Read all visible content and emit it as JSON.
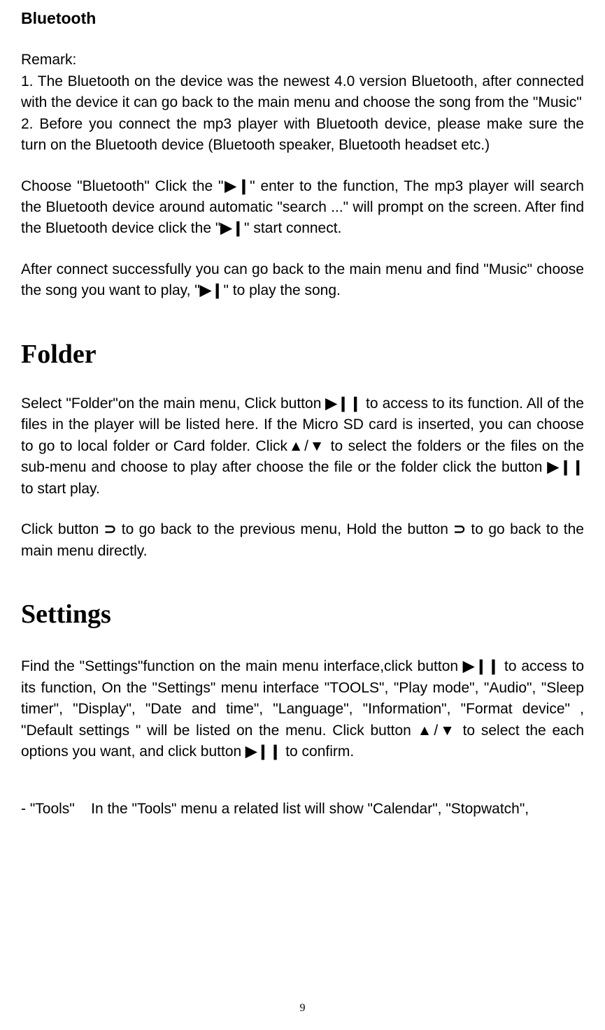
{
  "headings": {
    "bluetooth": "Bluetooth",
    "folder": "Folder",
    "settings": "Settings"
  },
  "paragraphs": {
    "remark_intro": "Remark:",
    "remark_1": "1. The Bluetooth on the device was the newest 4.0 version Bluetooth, after connected with the device it can go back to the main menu and choose the song from the \"Music\"",
    "remark_2": "2.  Before you connect the mp3 player with Bluetooth device, please make sure the turn on the Bluetooth device (Bluetooth speaker, Bluetooth headset etc.)",
    "bluetooth_choose_pre": "Choose \"Bluetooth\" Click the \"",
    "bluetooth_choose_mid": "\" enter to the function, The mp3 player will search the Bluetooth device around automatic \"search ...\" will prompt on the screen. After find the Bluetooth device click the \"",
    "bluetooth_choose_end": "\" start connect.",
    "bluetooth_after_pre": "After connect successfully you can go back to the main menu and find \"Music\" choose the song you want to play, \"",
    "bluetooth_after_end": "\" to play the song.",
    "folder_p1_pre": "Select \"Folder\"on the main menu, Click button ",
    "folder_p1_mid1": " to access to its function. All of the files in the player will be listed here. If the Micro SD card is inserted, you can choose to go to local folder or Card folder. Click▲/▼ to select the folders or the files on the sub-menu and choose to play after choose the file or the folder click the button ",
    "folder_p1_end": " to start play.",
    "folder_p2_pre": "Click button ",
    "folder_p2_mid": " to go back to the previous menu, Hold the button",
    "folder_p2_end": "to go back to the main menu directly.",
    "settings_p1_pre": "Find the \"Settings\"function on the main menu interface,click button ",
    "settings_p1_mid": " to access to its function, On the \"Settings\" menu interface \"TOOLS\", \"Play mode\", \"Audio\", \"Sleep timer\", \"Display\", \"Date and time\", \"Language\", \"Information\", \"Format device\" , \"Default settings \" will be listed on the menu. Click button ▲/▼ to select the each options you want, and click button ",
    "settings_p1_end": " to confirm.",
    "tools_prefix": "- \"Tools\"",
    "tools_gap": "    ",
    "tools_rest": "In the \"Tools\" menu a related list will show \"Calendar\", \"Stopwatch\","
  },
  "icons": {
    "play_pause_narrow": "▶❙",
    "play_pause": "▶❙❙",
    "back_arc": "⊃"
  },
  "page_number": "9"
}
